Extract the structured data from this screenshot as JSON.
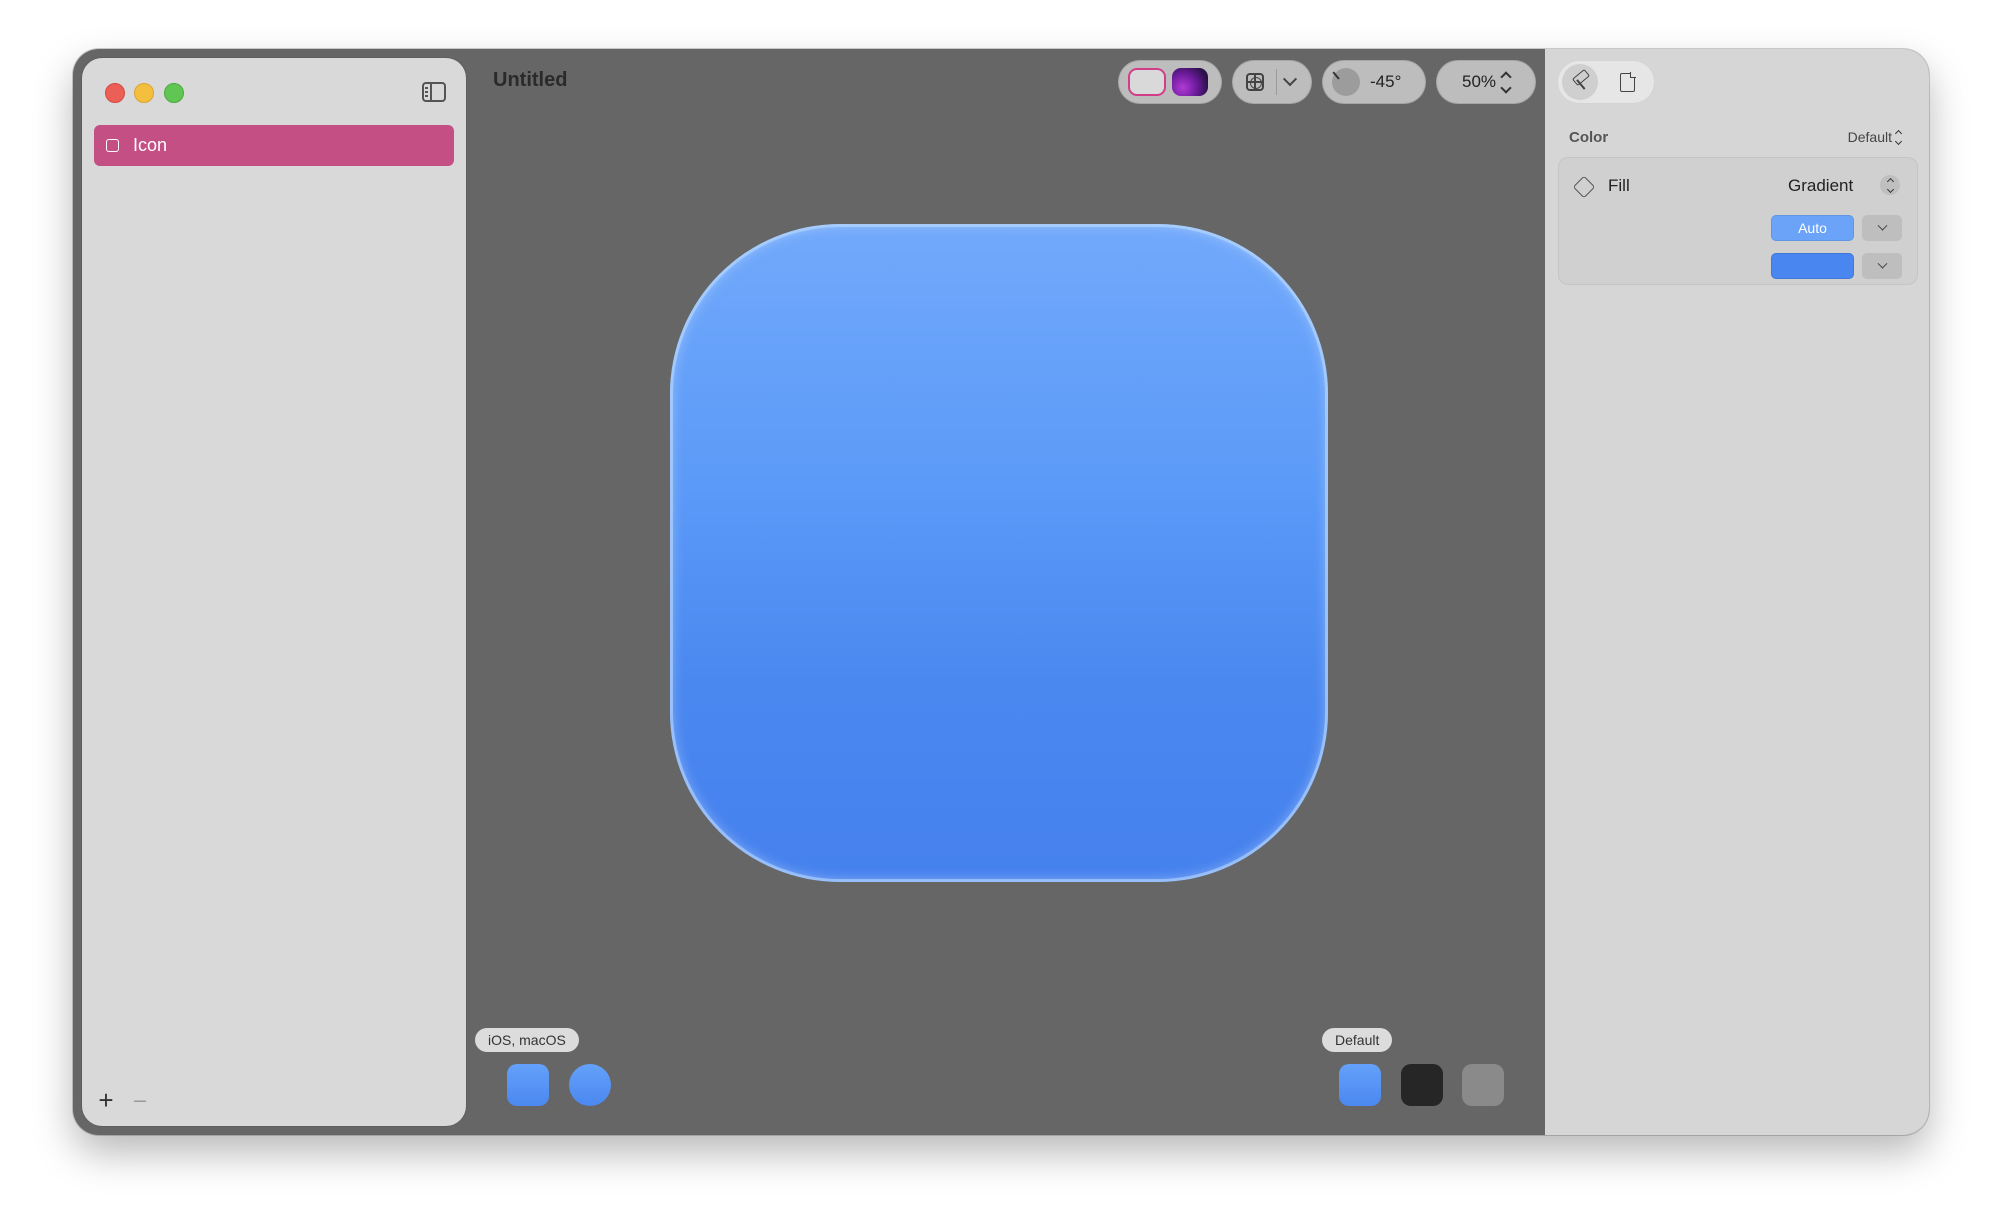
{
  "window": {
    "title": "Untitled"
  },
  "sidebar": {
    "layers": [
      {
        "label": "Icon",
        "selected": true
      }
    ],
    "add_label": "+",
    "remove_label": "–"
  },
  "toolbar": {
    "angle": "-45°",
    "zoom": "50%"
  },
  "canvas": {
    "icon_colors": {
      "top": "#72a9fb",
      "bottom": "#4681ee"
    },
    "platform_badge": "iOS, macOS",
    "variant_badge": "Default"
  },
  "inspector": {
    "section_title": "Color",
    "section_mode": "Default",
    "fill": {
      "label": "Fill",
      "type": "Gradient",
      "stop1_label": "Auto",
      "stop1_color": "#6aa3f8",
      "stop2_color": "#4a86f0"
    }
  },
  "colors": {
    "accent": "#c34f84",
    "canvas_bg": "#666666",
    "traffic_close": "#ec5f57",
    "traffic_minimize": "#f4be3f",
    "traffic_zoom": "#61c554"
  }
}
